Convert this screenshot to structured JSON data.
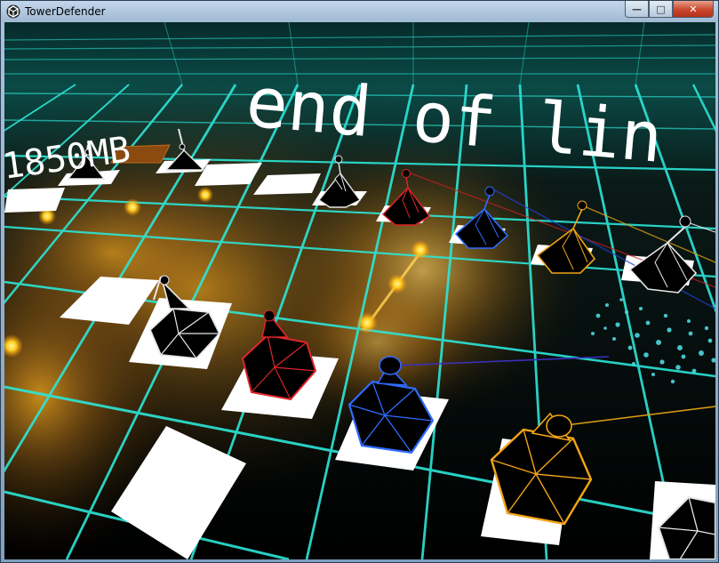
{
  "window": {
    "title": "TowerDefender",
    "min_symbol": "—",
    "max_symbol": "□",
    "close_symbol": "✕"
  },
  "hud": {
    "memory": "1850MB",
    "message": "end of lin"
  },
  "colors": {
    "grid": "#2ce6d8",
    "path_glow": "#ffb020",
    "tower_white": "#e8e8e8",
    "tower_red": "#e0252b",
    "tower_blue": "#2f6cff",
    "tower_orange": "#f2a516",
    "particles": "#4fd6de"
  },
  "towers": [
    {
      "color": "white",
      "row": "back"
    },
    {
      "color": "white",
      "row": "back"
    },
    {
      "color": "white",
      "row": "back"
    },
    {
      "color": "red",
      "row": "back"
    },
    {
      "color": "blue",
      "row": "back"
    },
    {
      "color": "orange",
      "row": "back"
    },
    {
      "color": "white",
      "row": "back"
    },
    {
      "color": "white",
      "row": "front"
    },
    {
      "color": "red",
      "row": "front"
    },
    {
      "color": "blue",
      "row": "front"
    },
    {
      "color": "orange",
      "row": "front"
    },
    {
      "color": "white",
      "row": "front"
    }
  ]
}
